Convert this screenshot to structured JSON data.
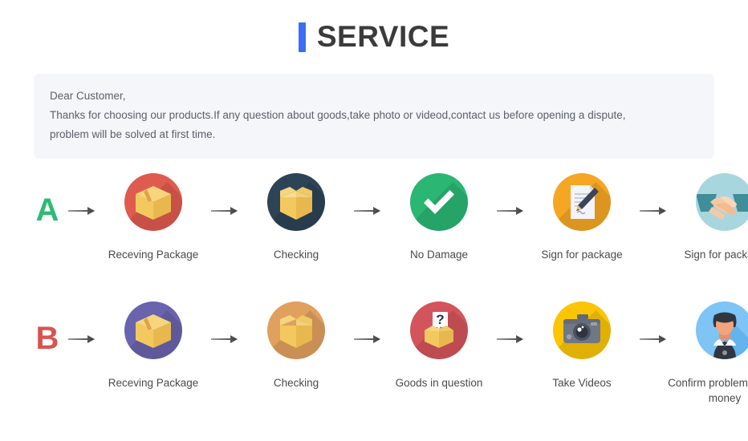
{
  "header": {
    "title": "SERVICE",
    "accent_color": "#3b6ef5"
  },
  "notice": {
    "line1": "Dear Customer,",
    "line2": "Thanks for choosing our products.If any question about goods,take photo or videod,contact us before opening a dispute,",
    "line3": "problem will be solved at first time.",
    "background_color": "#f5f6f9"
  },
  "flows": [
    {
      "letter": "A",
      "letter_color": "#2fbb74",
      "steps": [
        {
          "label": "Receving Package",
          "icon": "closed-box-icon",
          "circle_color": "#de5b4e"
        },
        {
          "label": "Checking",
          "icon": "open-box-icon",
          "circle_color": "#2d4356"
        },
        {
          "label": "No Damage",
          "icon": "check-mark-icon",
          "circle_color": "#2bb673"
        },
        {
          "label": "Sign for package",
          "icon": "document-pen-icon",
          "circle_color": "#f5a623"
        },
        {
          "label": "Sign for package",
          "icon": "handshake-icon",
          "circle_color": "#a8d6de"
        }
      ]
    },
    {
      "letter": "B",
      "letter_color": "#d9534f",
      "steps": [
        {
          "label": "Receving Package",
          "icon": "closed-box-icon",
          "circle_color": "#6a63ad"
        },
        {
          "label": "Checking",
          "icon": "open-box-icon",
          "circle_color": "#e0a05e"
        },
        {
          "label": "Goods in question",
          "icon": "question-box-icon",
          "circle_color": "#d4545c"
        },
        {
          "label": "Take Videos",
          "icon": "camera-icon",
          "circle_color": "#fbc505"
        },
        {
          "label": "Confirm  problem,refund money",
          "icon": "person-avatar-icon",
          "circle_color": "#7ec4f5"
        }
      ]
    }
  ],
  "arrow": {
    "name": "arrow-right-icon",
    "color": "#4f4f4f"
  }
}
